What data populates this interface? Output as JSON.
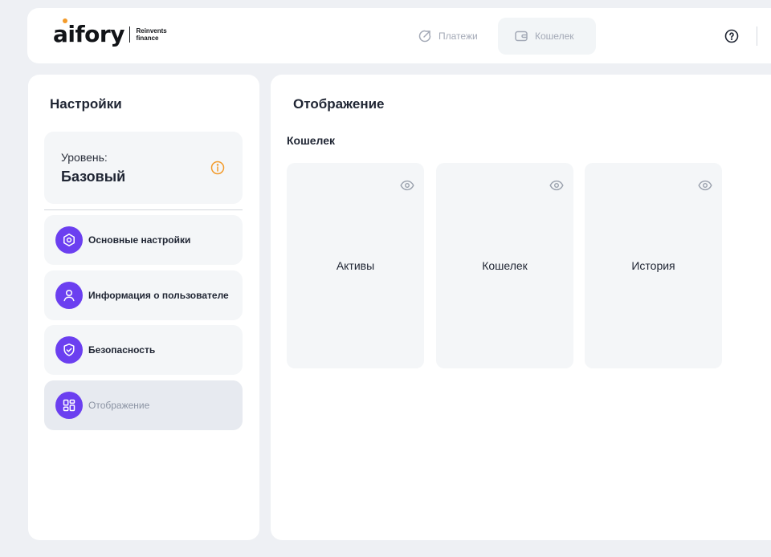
{
  "header": {
    "logo": {
      "wordmark": "aifory",
      "tagline_line1": "Reinvents",
      "tagline_line2": "finance"
    },
    "nav": [
      {
        "label": "Платежи",
        "icon": "arrow-up-right-icon",
        "active": false
      },
      {
        "label": "Кошелек",
        "icon": "wallet-icon",
        "active": true
      }
    ],
    "help_icon": "help-circle-icon"
  },
  "sidebar": {
    "title": "Настройки",
    "level": {
      "label": "Уровень:",
      "value": "Базовый",
      "icon": "info-icon",
      "icon_color": "#f39b2b"
    },
    "items": [
      {
        "label": "Основные настройки",
        "icon": "hexagon-settings-icon",
        "active": false
      },
      {
        "label": "Информация о пользователе",
        "icon": "user-icon",
        "active": false
      },
      {
        "label": "Безопасность",
        "icon": "shield-check-icon",
        "active": false
      },
      {
        "label": "Отображение",
        "icon": "layout-grid-icon",
        "active": true
      }
    ]
  },
  "main": {
    "title": "Отображение",
    "section_title": "Кошелек",
    "tiles": [
      {
        "label": "Активы",
        "icon": "eye-icon"
      },
      {
        "label": "Кошелек",
        "icon": "eye-icon"
      },
      {
        "label": "История",
        "icon": "eye-icon"
      }
    ]
  },
  "colors": {
    "accent": "#6b3ff0",
    "background": "#eef0f4",
    "card": "#f4f6f8",
    "warning": "#f39b2b"
  }
}
